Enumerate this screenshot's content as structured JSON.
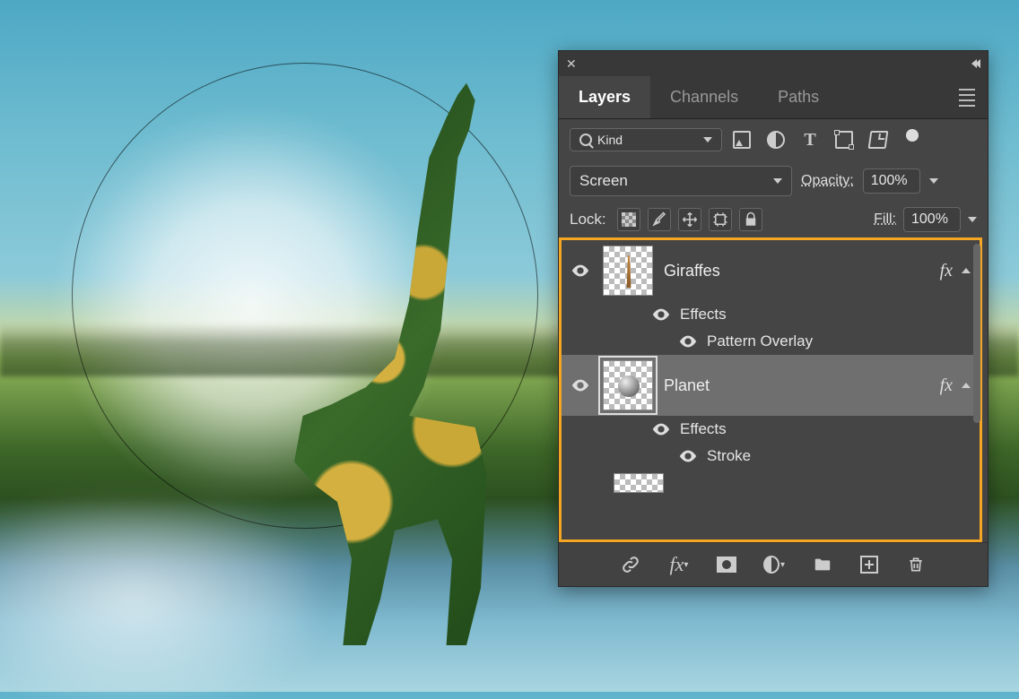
{
  "panel": {
    "tabs": {
      "layers": "Layers",
      "channels": "Channels",
      "paths": "Paths"
    },
    "filter": {
      "kind": "Kind"
    },
    "blend": {
      "mode": "Screen",
      "opacity_label": "Opacity:",
      "opacity_value": "100%",
      "fill_label": "Fill:",
      "fill_value": "100%"
    },
    "lock": {
      "label": "Lock:"
    },
    "layers": [
      {
        "name": "Giraffes",
        "selected": false,
        "effects_label": "Effects",
        "effects": [
          "Pattern Overlay"
        ]
      },
      {
        "name": "Planet",
        "selected": true,
        "effects_label": "Effects",
        "effects": [
          "Stroke"
        ]
      }
    ]
  }
}
